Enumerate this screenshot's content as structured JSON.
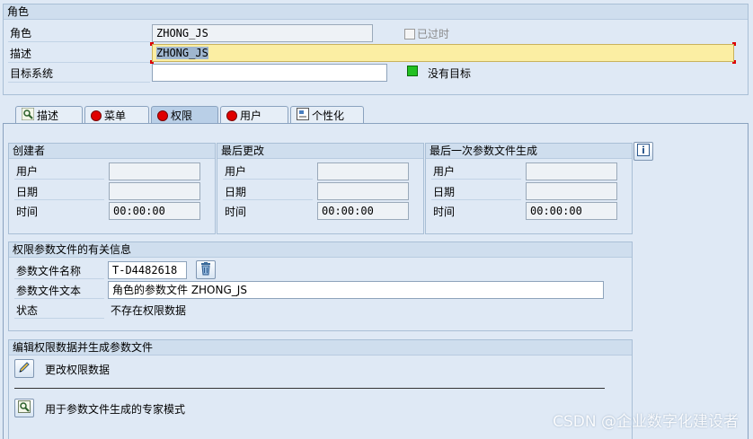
{
  "header": {
    "title": "角色",
    "role_label": "角色",
    "role_value": "ZHONG_JS",
    "obsolete_label": "已过时",
    "desc_label": "描述",
    "desc_value": "ZHONG_JS",
    "target_label": "目标系统",
    "target_value": "",
    "no_target_label": "没有目标"
  },
  "tabs": [
    {
      "label": "描述",
      "icon": "magnifier-icon"
    },
    {
      "label": "菜单",
      "icon": "red-status-icon"
    },
    {
      "label": "权限",
      "icon": "red-status-icon",
      "active": true
    },
    {
      "label": "用户",
      "icon": "red-status-icon"
    },
    {
      "label": "个性化",
      "icon": "personalize-icon"
    }
  ],
  "created": {
    "title": "创建者",
    "user_label": "用户",
    "user_value": "",
    "date_label": "日期",
    "date_value": "",
    "time_label": "时间",
    "time_value": "00:00:00"
  },
  "changed": {
    "title": "最后更改",
    "user_label": "用户",
    "user_value": "",
    "date_label": "日期",
    "date_value": "",
    "time_label": "时间",
    "time_value": "00:00:00"
  },
  "generated": {
    "title": "最后一次参数文件生成",
    "user_label": "用户",
    "user_value": "",
    "date_label": "日期",
    "date_value": "",
    "time_label": "时间",
    "time_value": "00:00:00"
  },
  "profile": {
    "title": "权限参数文件的有关信息",
    "name_label": "参数文件名称",
    "name_value": "T-D4482618",
    "text_label": "参数文件文本",
    "text_value": "角色的参数文件 ZHONG_JS",
    "status_label": "状态",
    "status_value": "不存在权限数据"
  },
  "edit": {
    "title": "编辑权限数据并生成参数文件",
    "change_label": "更改权限数据",
    "expert_label": "用于参数文件生成的专家模式"
  },
  "watermark": "CSDN @企业数字化建设者",
  "colors": {
    "status_red": "#e00000",
    "status_green": "#22c022",
    "highlight": "#fbeea3"
  }
}
